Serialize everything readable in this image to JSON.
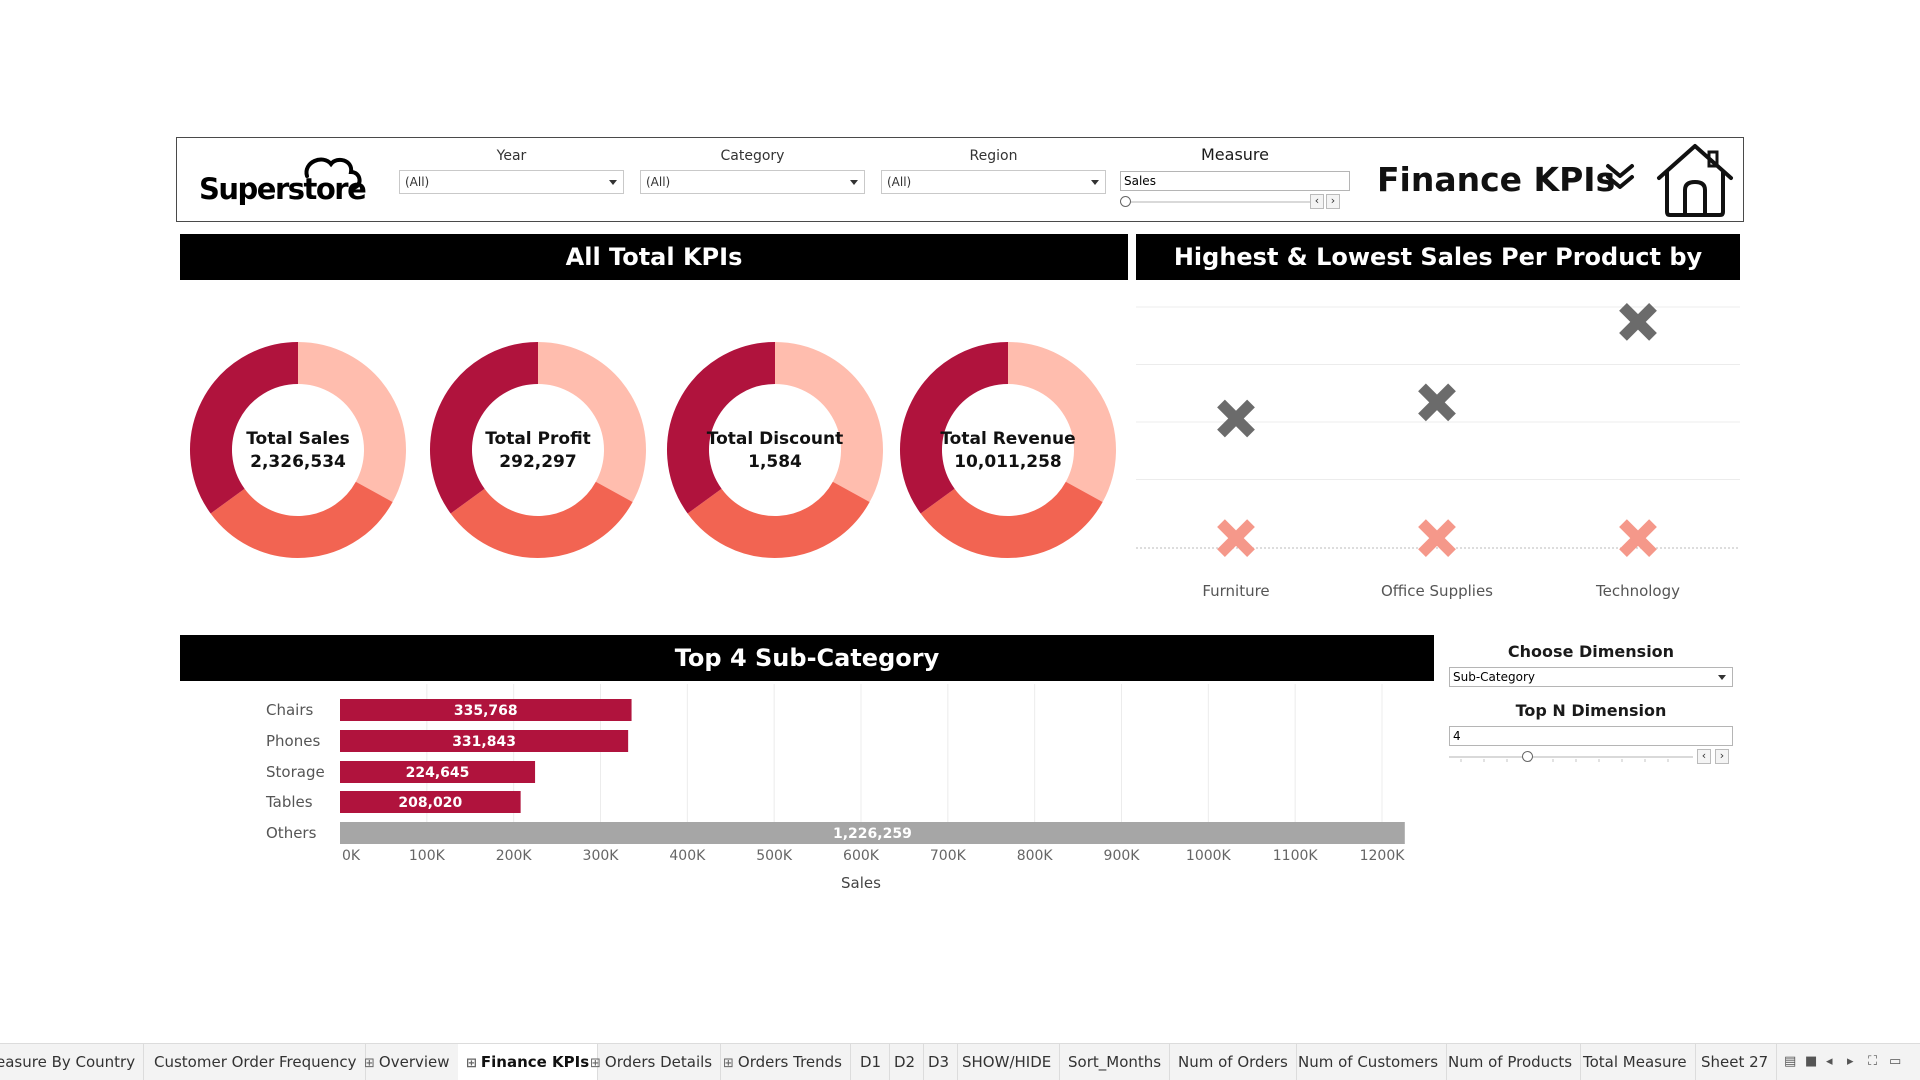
{
  "header": {
    "logo_text": "Superstore",
    "filters": [
      {
        "label": "Year",
        "value": "(All)"
      },
      {
        "label": "Category",
        "value": "(All)"
      },
      {
        "label": "Region",
        "value": "(All)"
      }
    ],
    "measure": {
      "label": "Measure",
      "value": "Sales",
      "slider_position": 0.0
    },
    "title": "Finance KPIs",
    "icons": [
      "double-chevron-down-icon",
      "home-icon"
    ]
  },
  "sections": {
    "kpis_title": "All Total KPIs",
    "hilo_title": "Highest & Lowest Sales Per Product by Category",
    "top4_title": "Top 4 Sub-Category"
  },
  "kpis": [
    {
      "label": "Total Sales",
      "value": "2,326,534"
    },
    {
      "label": "Total Profit",
      "value": "292,297"
    },
    {
      "label": "Total Discount",
      "value": "1,584"
    },
    {
      "label": "Total Revenue",
      "value": "10,011,258"
    }
  ],
  "colors": {
    "donut_dark": "#b0133d",
    "donut_mid": "#f26452",
    "donut_light": "#ffbdae",
    "bar_main": "#b0133d",
    "bar_other": "#a6a6a6",
    "mark_high": "#6b6b6b",
    "mark_low": "#f5988a"
  },
  "chart_data": [
    {
      "type": "scatter",
      "title": "Highest & Lowest Sales Per Product by Category",
      "categories": [
        "Furniture",
        "Office Supplies",
        "Technology"
      ],
      "series": [
        {
          "name": "Highest",
          "values": [
            0.55,
            0.62,
            0.97
          ]
        },
        {
          "name": "Lowest",
          "values": [
            0.03,
            0.03,
            0.03
          ]
        }
      ],
      "axis_labels_shown": false,
      "marker": "x-cross"
    },
    {
      "type": "bar",
      "orientation": "horizontal",
      "title": "Top 4 Sub-Category",
      "categories": [
        "Chairs",
        "Phones",
        "Storage",
        "Tables",
        "Others"
      ],
      "values": [
        335768,
        331843,
        224645,
        208020,
        1226259
      ],
      "value_labels": [
        "335,768",
        "331,843",
        "224,645",
        "208,020",
        "1,226,259"
      ],
      "xlabel": "Sales",
      "ylabel": "",
      "xlim": [
        0,
        1200000
      ],
      "xticks": [
        "0K",
        "100K",
        "200K",
        "300K",
        "400K",
        "500K",
        "600K",
        "700K",
        "800K",
        "900K",
        "1000K",
        "1100K",
        "1200K"
      ],
      "grid": "vertical"
    }
  ],
  "controls": {
    "choose_dimension": {
      "label": "Choose Dimension",
      "value": "Sub-Category"
    },
    "top_n": {
      "label": "Top N Dimension",
      "value": "4",
      "slider_position": 0.3
    }
  },
  "tabs": [
    {
      "label": "easure By Country",
      "grid": false
    },
    {
      "label": "Customer Order Frequency",
      "grid": false
    },
    {
      "label": "Overview",
      "grid": true
    },
    {
      "label": "Finance KPIs",
      "grid": true,
      "active": true
    },
    {
      "label": "Orders Details",
      "grid": true
    },
    {
      "label": "Orders Trends",
      "grid": true
    },
    {
      "label": "D1",
      "grid": false
    },
    {
      "label": "D2",
      "grid": false
    },
    {
      "label": "D3",
      "grid": false
    },
    {
      "label": "SHOW/HIDE",
      "grid": false
    },
    {
      "label": "Sort_Months",
      "grid": false
    },
    {
      "label": "Num of Orders",
      "grid": false
    },
    {
      "label": "Num of Customers",
      "grid": false
    },
    {
      "label": "Num of Products",
      "grid": false
    },
    {
      "label": "Total Measure",
      "grid": false
    },
    {
      "label": "Sheet 27",
      "grid": false
    }
  ],
  "tab_tools": [
    "grid-view-icon",
    "single-view-icon",
    "prev-icon",
    "next-icon",
    "fit-icon",
    "presentation-icon"
  ]
}
